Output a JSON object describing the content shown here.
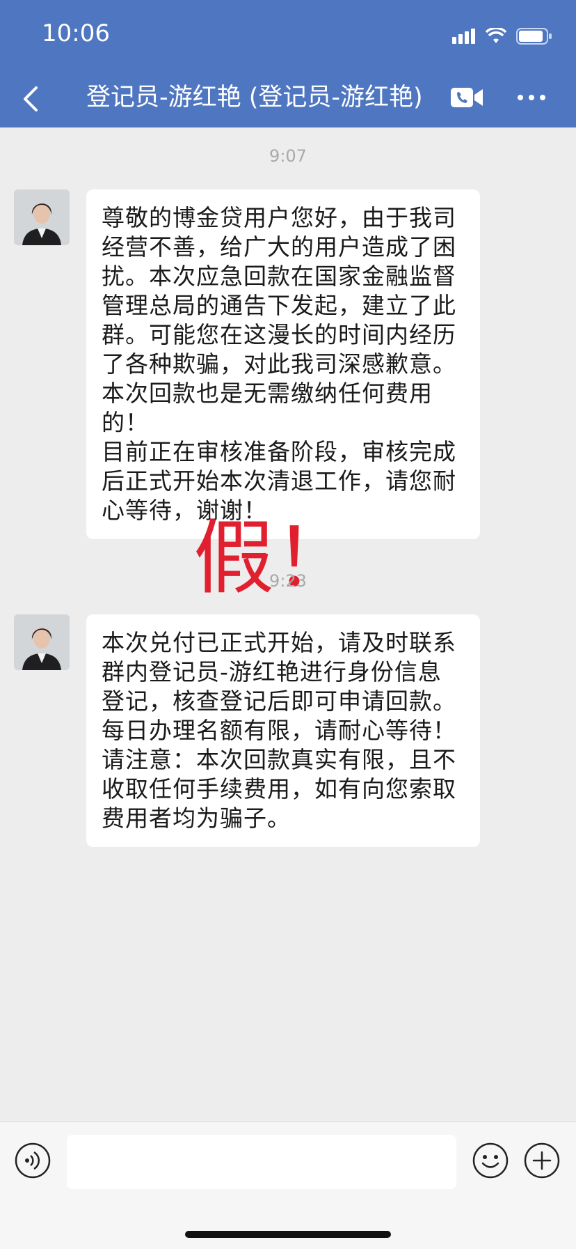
{
  "status_bar": {
    "time": "10:06"
  },
  "header": {
    "title": "登记员-游红艳 (登记员-游红艳)",
    "icons": [
      "back-icon",
      "video-call-icon",
      "more-icon"
    ]
  },
  "messages": [
    {
      "time": "9:07",
      "text": "尊敬的博金贷用户您好，由于我司经营不善，给广大的用户造成了困扰。本次应急回款在国家金融监督管理总局的通告下发起，建立了此群。可能您在这漫长的时间内经历了各种欺骗，对此我司深感歉意。本次回款也是无需缴纳任何费用的！\n目前正在审核准备阶段，审核完成后正式开始本次清退工作，请您耐心等待，谢谢！"
    },
    {
      "time": "9:23",
      "text": "本次兑付已正式开始，请及时联系群内登记员-游红艳进行身份信息登记，核查登记后即可申请回款。每日办理名额有限，请耐心等待！\n请注意：本次回款真实有限，且不收取任何手续费用，如有向您索取费用者均为骗子。"
    }
  ],
  "overlay_stamp": "假！",
  "input_bar": {
    "placeholder": "",
    "icons": [
      "voice-icon",
      "emoji-icon",
      "plus-icon"
    ]
  },
  "colors": {
    "header": "#4f76c1",
    "stamp": "#e0202f",
    "background": "#ededed"
  }
}
